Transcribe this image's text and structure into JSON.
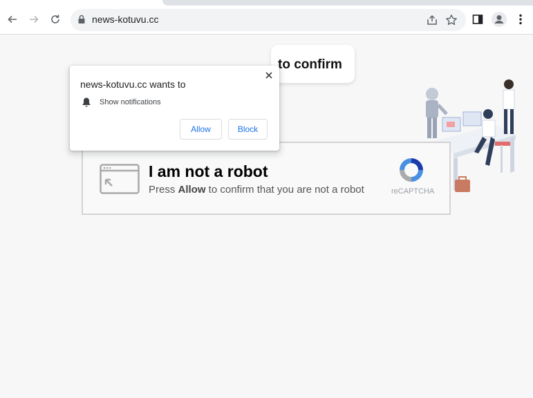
{
  "browser": {
    "url": "news-kotuvu.cc",
    "icons": [
      "back-icon",
      "forward-icon",
      "reload-icon",
      "lock-icon",
      "share-icon",
      "star-icon",
      "side-panel-icon",
      "profile-icon",
      "menu-icon"
    ]
  },
  "permission_prompt": {
    "title": "news-kotuvu.cc wants to",
    "permission": "Show notifications",
    "allow_label": "Allow",
    "block_label": "Block"
  },
  "page": {
    "confirm_text": "to confirm",
    "captcha": {
      "heading": "I am not a robot",
      "sub_prefix": "Press ",
      "sub_bold": "Allow",
      "sub_suffix": " to confirm that you are not a robot",
      "brand": "reCAPTCHA"
    }
  },
  "colors": {
    "accent": "#1a73e8",
    "page_bg": "#f7f7f8",
    "recaptcha_blue": "#4a90e2"
  }
}
